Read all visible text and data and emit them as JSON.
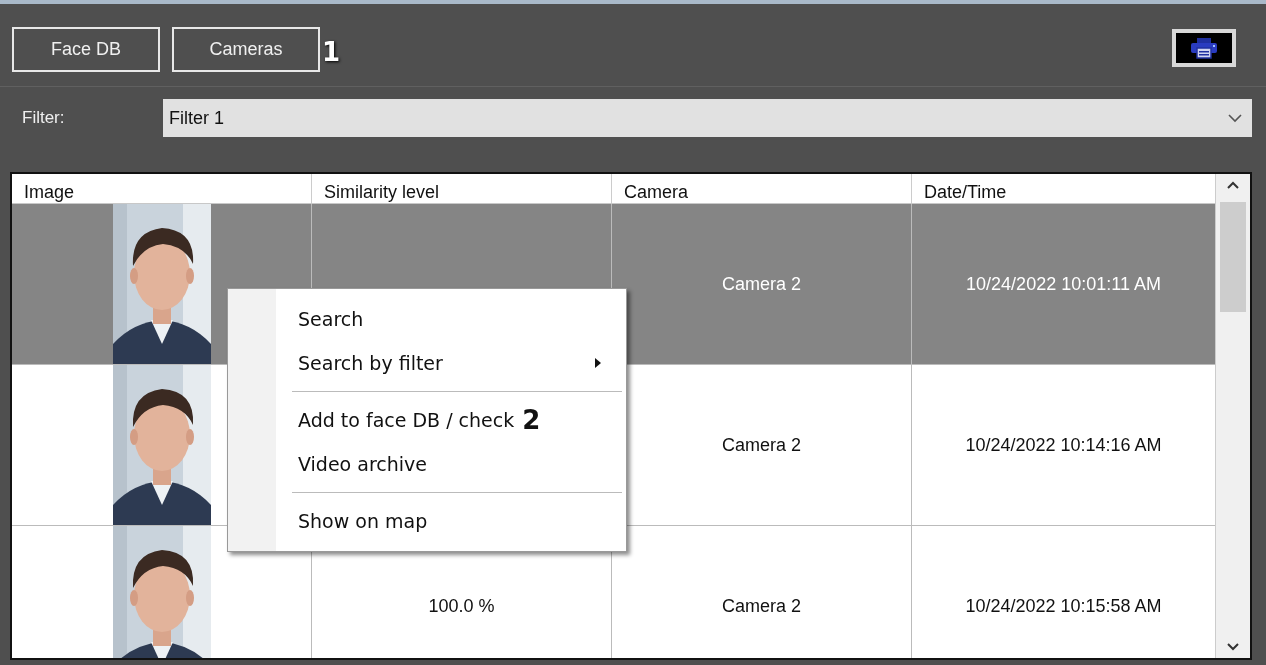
{
  "toolbar": {
    "buttons": [
      {
        "label": "Face DB"
      },
      {
        "label": "Cameras"
      }
    ],
    "callout": "1"
  },
  "filter": {
    "label": "Filter:",
    "value": "Filter 1"
  },
  "table": {
    "columns": [
      "Image",
      "Similarity level",
      "Camera",
      "Date/Time"
    ],
    "rows": [
      {
        "camera": "Camera 2",
        "datetime": "10/24/2022 10:01:11 AM",
        "selected": true
      },
      {
        "camera": "Camera 2",
        "datetime": "10/24/2022 10:14:16 AM",
        "selected": false
      },
      {
        "similarity": "100.0 %",
        "camera": "Camera 2",
        "datetime": "10/24/2022 10:15:58 AM",
        "selected": false
      }
    ]
  },
  "context_menu": {
    "items": [
      {
        "kind": "item",
        "label": "Search"
      },
      {
        "kind": "submenu",
        "label": "Search by filter"
      },
      {
        "kind": "separator"
      },
      {
        "kind": "item",
        "label": "Add to face DB / check",
        "callout": "2"
      },
      {
        "kind": "item",
        "label": "Video archive"
      },
      {
        "kind": "separator"
      },
      {
        "kind": "item",
        "label": "Show on map"
      }
    ]
  }
}
